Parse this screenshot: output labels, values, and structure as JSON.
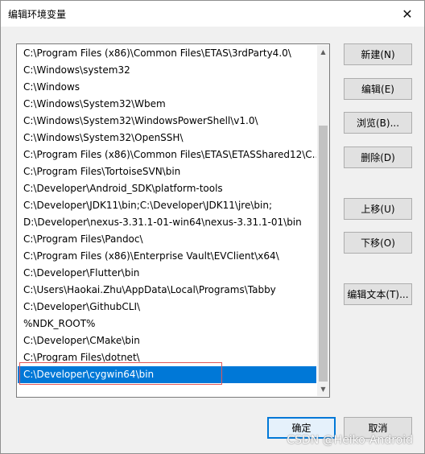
{
  "window": {
    "title": "编辑环境变量",
    "close_glyph": "✕"
  },
  "list": {
    "items": [
      "C:\\Program Files (x86)\\Common Files\\ETAS\\3rdParty4.0\\",
      "C:\\Windows\\system32",
      "C:\\Windows",
      "C:\\Windows\\System32\\Wbem",
      "C:\\Windows\\System32\\WindowsPowerShell\\v1.0\\",
      "C:\\Windows\\System32\\OpenSSH\\",
      "C:\\Program Files (x86)\\Common Files\\ETAS\\ETASShared12\\C...",
      "C:\\Program Files\\TortoiseSVN\\bin",
      "C:\\Developer\\Android_SDK\\platform-tools",
      "C:\\Developer\\JDK11\\bin;C:\\Developer\\JDK11\\jre\\bin;",
      "D:\\Developer\\nexus-3.31.1-01-win64\\nexus-3.31.1-01\\bin",
      "C:\\Program Files\\Pandoc\\",
      "C:\\Program Files (x86)\\Enterprise Vault\\EVClient\\x64\\",
      "C:\\Developer\\Flutter\\bin",
      "C:\\Users\\Haokai.Zhu\\AppData\\Local\\Programs\\Tabby",
      "C:\\Developer\\GithubCLI\\",
      "%NDK_ROOT%",
      "C:\\Developer\\CMake\\bin",
      "C:\\Program Files\\dotnet\\",
      "C:\\Developer\\cygwin64\\bin"
    ],
    "selected_index": 19
  },
  "buttons": {
    "new": "新建(N)",
    "edit": "编辑(E)",
    "browse": "浏览(B)...",
    "delete": "删除(D)",
    "move_up": "上移(U)",
    "move_down": "下移(O)",
    "edit_text": "编辑文本(T)...",
    "ok": "确定",
    "cancel": "取消"
  },
  "icons": {
    "scroll_up": "▲",
    "scroll_down": "▼"
  },
  "colors": {
    "selection": "#0078d7",
    "highlight_box": "#e05858"
  },
  "watermark": "CSDN @Heiko-Android"
}
